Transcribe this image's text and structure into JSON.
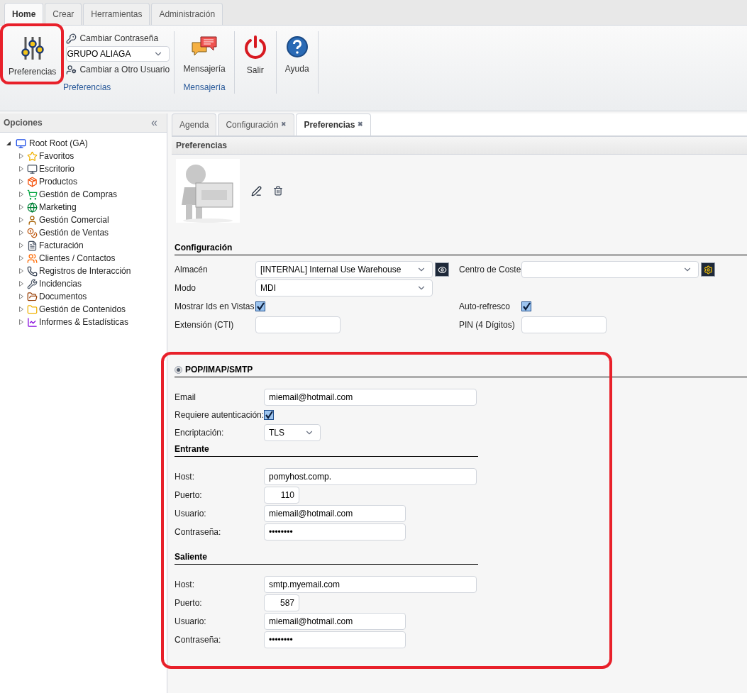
{
  "top_tabs": [
    {
      "label": "Home",
      "selected": true
    },
    {
      "label": "Crear",
      "selected": false
    },
    {
      "label": "Herramientas",
      "selected": false
    },
    {
      "label": "Administración",
      "selected": false
    }
  ],
  "ribbon": {
    "groups": [
      {
        "label": "Preferencias",
        "big_button": "Preferencias",
        "links": [
          "Cambiar Contraseña",
          "Cambiar a Otro Usuario"
        ],
        "company_select": "GRUPO ALIAGA"
      },
      {
        "label": "Mensajería",
        "big_button": "Mensajería"
      },
      {
        "big_button": "Salir"
      },
      {
        "big_button": "Ayuda"
      }
    ]
  },
  "sidebar": {
    "title": "Opciones",
    "collapse": "«",
    "tree": {
      "label": "Root Root (GA)",
      "expanded": true,
      "children": [
        {
          "label": "Favoritos",
          "expanded": false
        },
        {
          "label": "Escritorio",
          "expanded": false
        },
        {
          "label": "Productos",
          "expanded": false
        },
        {
          "label": "Gestión de Compras",
          "expanded": false
        },
        {
          "label": "Marketing",
          "expanded": false
        },
        {
          "label": "Gestión Comercial",
          "expanded": false
        },
        {
          "label": "Gestión de Ventas",
          "expanded": false
        },
        {
          "label": "Facturación",
          "expanded": false
        },
        {
          "label": "Clientes / Contactos",
          "expanded": false
        },
        {
          "label": "Registros de Interacción",
          "expanded": false
        },
        {
          "label": "Incidencias",
          "expanded": false
        },
        {
          "label": "Documentos",
          "expanded": false
        },
        {
          "label": "Gestión de Contenidos",
          "expanded": false
        },
        {
          "label": "Informes & Estadísticas",
          "expanded": false
        }
      ]
    }
  },
  "doc_tabs": [
    {
      "label": "Agenda",
      "selected": false,
      "closable": false
    },
    {
      "label": "Configuración",
      "selected": false,
      "closable": true
    },
    {
      "label": "Preferencias",
      "selected": true,
      "closable": true
    }
  ],
  "close_glyph": "✖",
  "panel_title": "Preferencias",
  "configuration": {
    "title": "Configuración",
    "rows": [
      [
        {
          "label": "Almacén",
          "kind": "select",
          "value": "[INTERNAL] Internal Use Warehouse",
          "button": true
        },
        {
          "label": "Centro de Coste",
          "kind": "select",
          "button": true
        }
      ],
      [
        {
          "label": "Modo",
          "kind": "select",
          "value": "MDI",
          "button": false
        }
      ],
      [
        {
          "label": "Mostrar Ids en Vistas",
          "kind": "checkbox",
          "checked": true
        },
        {
          "label": "Auto-refresco",
          "kind": "checkbox",
          "checked": true
        }
      ],
      [
        {
          "label": "Extensión (CTI)",
          "kind": "text"
        },
        {
          "label": "PIN (4 Dígitos)",
          "kind": "text"
        }
      ]
    ]
  },
  "mail": {
    "title": "POP/IMAP/SMTP",
    "selected": true,
    "fields": [
      {
        "label": "Email",
        "kind": "text",
        "value": "miemail@hotmail.com"
      },
      {
        "label": "Requiere autenticación:",
        "kind": "checkbox",
        "checked": true
      },
      {
        "label": "Encriptación:",
        "kind": "select",
        "value": "TLS"
      }
    ],
    "sections": [
      {
        "title": "Entrante",
        "fields": [
          {
            "label": "Host:",
            "kind": "text",
            "value": "pomyhost.comp."
          },
          {
            "label": "Puerto:",
            "kind": "number",
            "value": "110"
          },
          {
            "label": "Usuario:",
            "kind": "medium",
            "value": "miemail@hotmail.com"
          },
          {
            "label": "Contraseña:",
            "kind": "medium",
            "value": "••••••••"
          }
        ]
      },
      {
        "title": "Saliente",
        "fields": [
          {
            "label": "Host:",
            "kind": "text",
            "value": "smtp.myemail.com"
          },
          {
            "label": "Puerto:",
            "kind": "number",
            "value": "587"
          },
          {
            "label": "Usuario:",
            "kind": "medium",
            "value": "miemail@hotmail.com"
          },
          {
            "label": "Contraseña:",
            "kind": "medium",
            "value": "••••••••"
          }
        ]
      }
    ]
  }
}
